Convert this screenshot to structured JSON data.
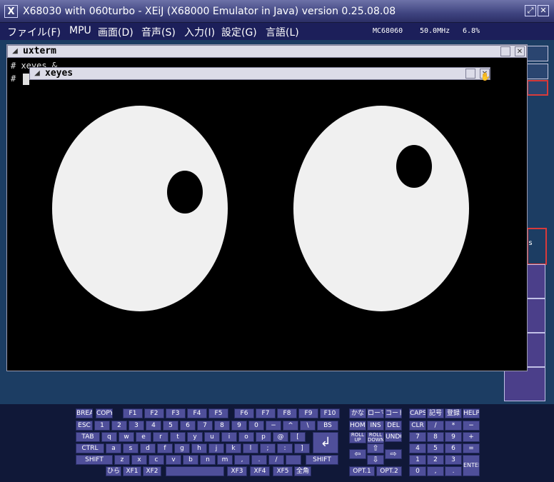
{
  "window": {
    "icon": "X",
    "title": "X68030 with 060turbo - XEiJ (X68000 Emulator in Java) version 0.25.08.08",
    "controls": [
      "⤢",
      "✕"
    ]
  },
  "menubar": {
    "items": [
      {
        "label": "ファイル(F)"
      },
      {
        "label": "MPU"
      },
      {
        "label": "画面(D)"
      },
      {
        "label": "音声(S)"
      },
      {
        "label": "入力(I)"
      },
      {
        "label": "設定(G)"
      },
      {
        "label": "言語(L)"
      }
    ],
    "status": {
      "cpu": "MC68060",
      "clock": "50.0MHz",
      "load": "6.8%"
    }
  },
  "screen": {
    "rightpanel_text": "s",
    "uxterm": {
      "title": "uxterm",
      "menu_glyph": "◢",
      "close_glyph": "✕",
      "lines": [
        "# xeyes &",
        "#"
      ]
    },
    "xeyes": {
      "title": "xeyes",
      "menu_glyph": "◢",
      "close_glyph": "✕"
    }
  },
  "keyboard": {
    "function_row": [
      "BREAK",
      "COPY",
      "F1",
      "F2",
      "F3",
      "F4",
      "F5",
      "F6",
      "F7",
      "F8",
      "F9",
      "F10",
      "かな",
      "ローマ",
      "コード",
      "CAPS",
      "記号",
      "登録",
      "HELP"
    ],
    "main_rows": [
      [
        "ESC",
        "1",
        "2",
        "3",
        "4",
        "5",
        "6",
        "7",
        "8",
        "9",
        "0",
        "−",
        "^",
        "\\",
        "BS"
      ],
      [
        "TAB",
        "q",
        "w",
        "e",
        "r",
        "t",
        "y",
        "u",
        "i",
        "o",
        "p",
        "@",
        "["
      ],
      [
        "CTRL",
        "a",
        "s",
        "d",
        "f",
        "g",
        "h",
        "j",
        "k",
        "l",
        ";",
        ":",
        "]"
      ],
      [
        "SHIFT",
        "z",
        "x",
        "c",
        "v",
        "b",
        "n",
        "m",
        ",",
        ".",
        "/",
        "",
        "SHIFT"
      ],
      [
        "ひら",
        "XF1",
        "XF2",
        "",
        "XF3",
        "XF4",
        "XF5",
        "全角"
      ]
    ],
    "enter_glyph": "↲",
    "nav": [
      "HOME",
      "INS",
      "DEL",
      "ROLL UP",
      "ROLL DOWN",
      "UNDO",
      "⇦",
      "⇧",
      "⇨",
      "⇩",
      "OPT.1",
      "OPT.2"
    ],
    "numpad": [
      "CLR",
      "/",
      "*",
      "−",
      "7",
      "8",
      "9",
      "+",
      "4",
      "5",
      "6",
      "=",
      "1",
      "2",
      "3",
      "ENTER",
      "0",
      ",",
      "."
    ]
  }
}
